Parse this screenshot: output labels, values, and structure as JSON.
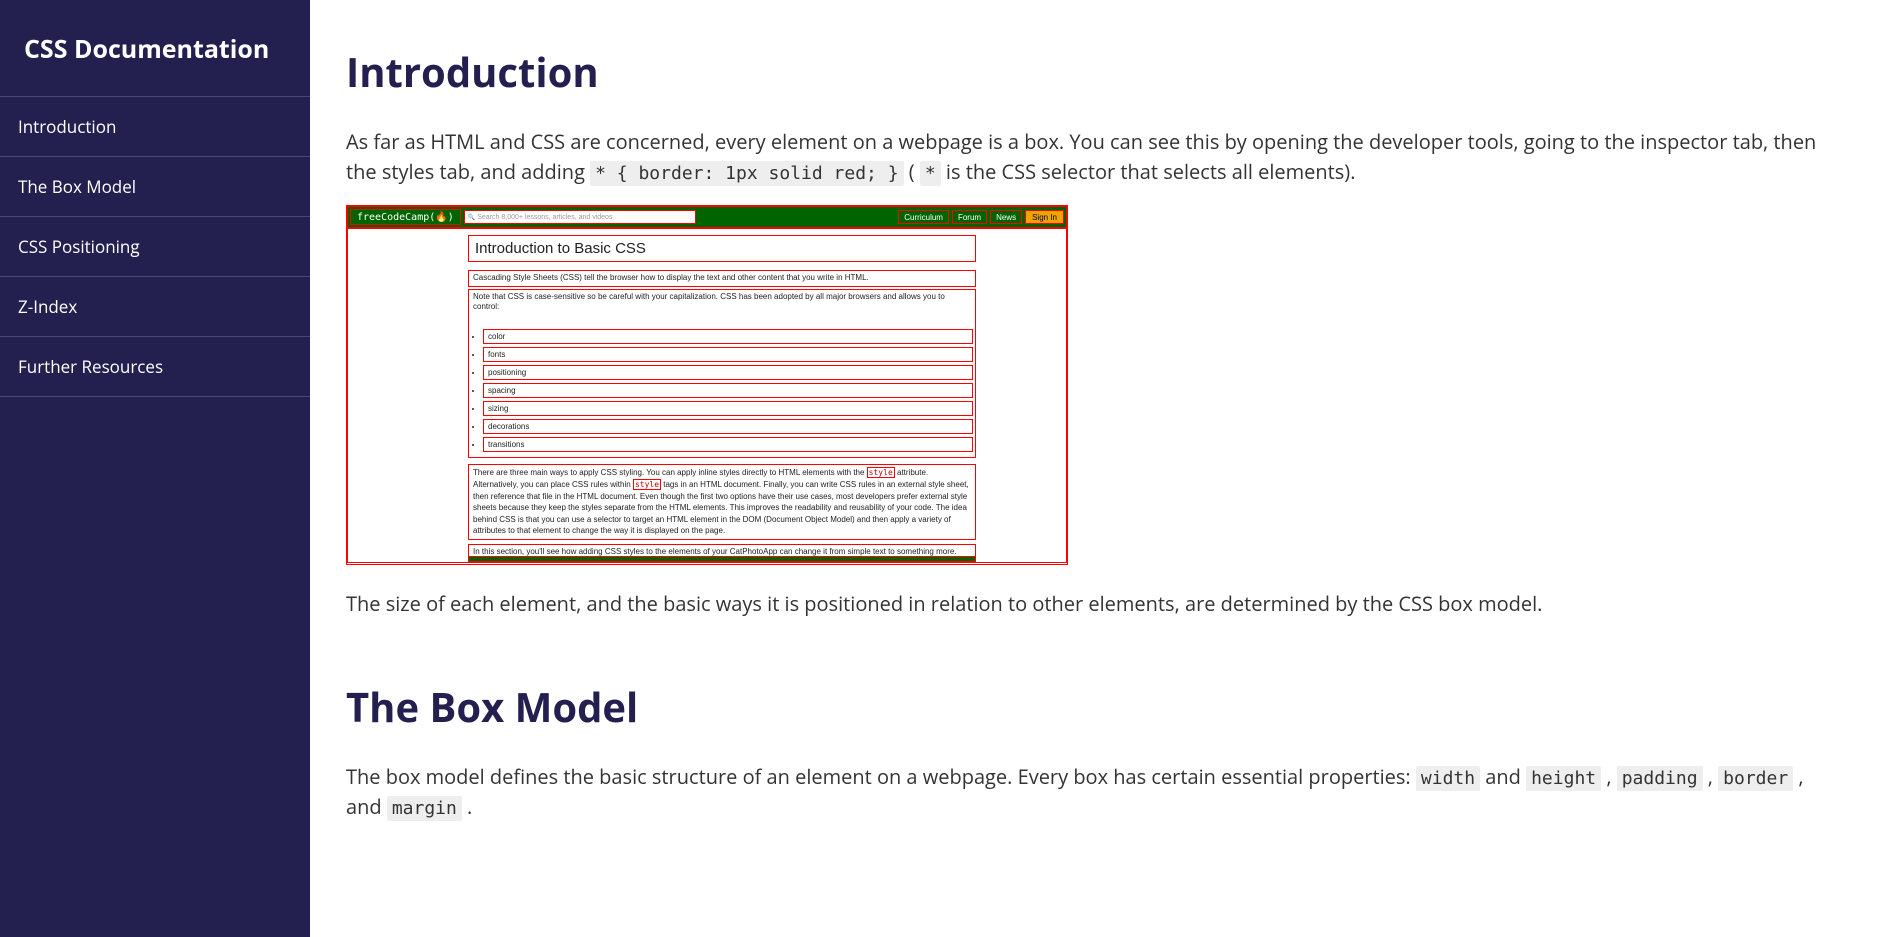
{
  "sidebar": {
    "title": "CSS Documentation",
    "items": [
      {
        "label": "Introduction"
      },
      {
        "label": "The Box Model"
      },
      {
        "label": "CSS Positioning"
      },
      {
        "label": "Z-Index"
      },
      {
        "label": "Further Resources"
      }
    ]
  },
  "intro": {
    "heading": "Introduction",
    "p1_a": "As far as HTML and CSS are concerned, every element on a webpage is a box. You can see this by opening the developer tools, going to the inspector tab, then the styles tab, and adding ",
    "code1": "* { border: 1px solid red; }",
    "p1_b": " (",
    "code2": "*",
    "p1_c": " is the CSS selector that selects all elements).",
    "p2": "The size of each element, and the basic ways it is positioned in relation to other elements, are determined by the CSS box model."
  },
  "fcc": {
    "logo": "freeCodeCamp(🔥)",
    "search_placeholder": "Search 8,000+ lessons, articles, and videos",
    "links": [
      "Curriculum",
      "Forum",
      "News"
    ],
    "signin": "Sign In",
    "content_title": "Introduction to Basic CSS",
    "para1": "Cascading Style Sheets (CSS) tell the browser how to display the text and other content that you write in HTML.",
    "para2": "Note that CSS is case-sensitive so be careful with your capitalization. CSS has been adopted by all major browsers and allows you to control:",
    "bullets": [
      "color",
      "fonts",
      "positioning",
      "spacing",
      "sizing",
      "decorations",
      "transitions"
    ],
    "long_a": "There are three main ways to apply CSS styling. You can apply inline styles directly to HTML elements with the ",
    "kw1": "style",
    "long_b": " attribute. Alternatively, you can place CSS rules within ",
    "kw2": "style",
    "long_c": " tags in an HTML document. Finally, you can write CSS rules in an external style sheet, then reference that file in the HTML document. Even though the first two options have their use cases, most developers prefer external style sheets because they keep the styles separate from the HTML elements. This improves the readability and reusability of your code. The idea behind CSS is that you can use a selector to target an HTML element in the DOM (Document Object Model) and then apply a variety of attributes to that element to change the way it is displayed on the page.",
    "para3": "In this section, you'll see how adding CSS styles to the elements of your CatPhotoApp can change it from simple text to something more."
  },
  "boxmodel": {
    "heading": "The Box Model",
    "p1_a": "The box model defines the basic structure of an element on a webpage. Every box has certain essential properties: ",
    "c1": "width",
    "t1": " and ",
    "c2": "height",
    "t2": ", ",
    "c3": "padding",
    "t3": ", ",
    "c4": "border",
    "t4": ", and ",
    "c5": "margin",
    "t5": "."
  }
}
